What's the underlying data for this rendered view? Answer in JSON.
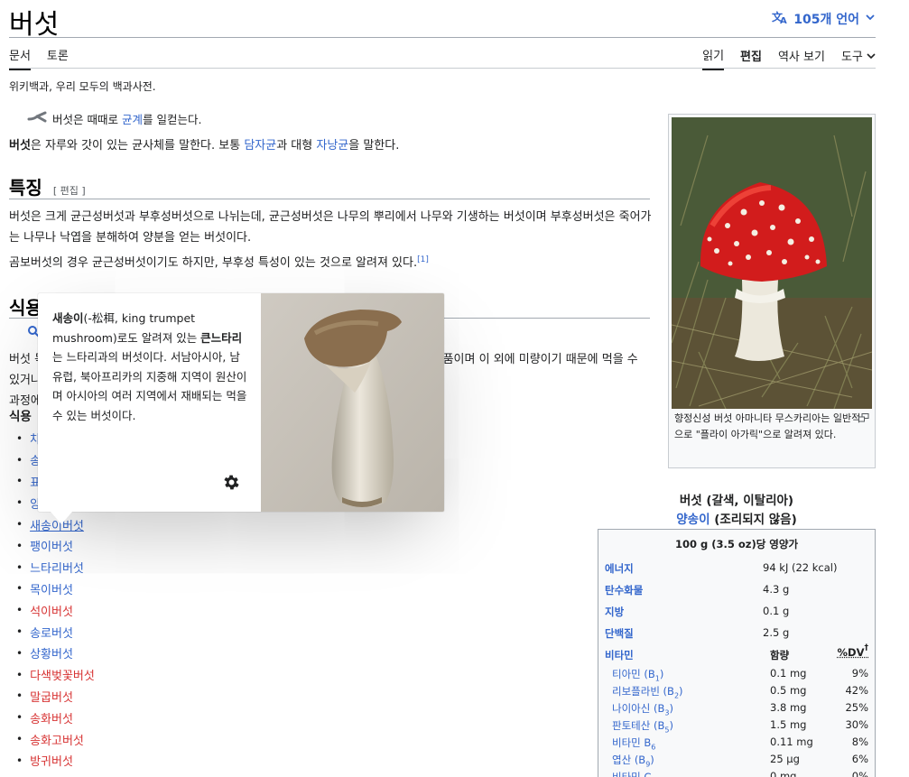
{
  "header": {
    "title": "버섯",
    "languages_label": "105개 언어"
  },
  "tabs_left": [
    "문서",
    "토론"
  ],
  "tabs_right": {
    "read": "읽기",
    "edit": "편집",
    "history": "역사 보기",
    "tools": "도구"
  },
  "tagline": "위키백과, 우리 모두의 백과사전.",
  "hatnote": {
    "before": "버섯은 때때로 ",
    "link": "균계",
    "after": "를 일컫는다."
  },
  "intro": {
    "bold": "버섯",
    "t1": "은 자루와 갓이 있는 균사체를 말한다. 보통 ",
    "link1": "담자균",
    "t2": "과 대형 ",
    "link2": "자낭균",
    "t3": "을 말한다."
  },
  "section1": {
    "heading": "특징",
    "edit_label": "[ 편집 ]",
    "para1": "버섯은 크게 균근성버섯과 부후성버섯으로 나뉘는데, 균근성버섯은 나무의 뿌리에서 나무와 기생하는 버섯이며 부후성버섯은 죽어가는 나무나 낙엽을 분해하여 양분을 얻는 버섯이다.",
    "para2": "곰보버섯의 경우 균근성버섯이기도 하지만, 부후성 특성이 있는 것으로 알려져 있다.",
    "ref": "[1]"
  },
  "section2": {
    "heading": "식용",
    "para_part1": "버섯",
    "para_part2": "독이 있는 것도 있다. 하지만 대부분 저칼로리, 저지방, 고섬유질 식품이어서 건강 식품이며 이 외에 미량이기 때문에 먹을 수 있거나 조리",
    "para_part3": "과정에",
    "para_end": "흔히",
    "subhead": "식용"
  },
  "food_list": [
    {
      "label": "차",
      "red": false
    },
    {
      "label": "송",
      "red": false
    },
    {
      "label": "표",
      "red": false
    },
    {
      "label": "양",
      "red": false
    },
    {
      "label": "새송이버섯",
      "red": false
    },
    {
      "label": "팽이버섯",
      "red": false
    },
    {
      "label": "느타리버섯",
      "red": false
    },
    {
      "label": "목이버섯",
      "red": false
    },
    {
      "label": "석이버섯",
      "red": true
    },
    {
      "label": "송로버섯",
      "red": false
    },
    {
      "label": "상황버섯",
      "red": false
    },
    {
      "label": "다색벚꽃버섯",
      "red": true
    },
    {
      "label": "말굽버섯",
      "red": true
    },
    {
      "label": "송화버섯",
      "red": true
    },
    {
      "label": "송화고버섯",
      "red": true
    },
    {
      "label": "방귀버섯",
      "red": true
    }
  ],
  "thumb": {
    "caption": "향정신성 버섯 아마니타 무스카리아는 일반적으로 \"플라이 아가릭\"으로 알려져 있다."
  },
  "infobox": {
    "title_line1": "버섯 (갈색, 이탈리아)",
    "title_link": "양송이",
    "title_rest": " (조리되지 않음)",
    "per": "100 g (3.5 oz)당 영양가",
    "rows": [
      {
        "k": "에너지",
        "v": "94 kJ (22 kcal)"
      },
      {
        "k": "탄수화물",
        "v": "4.3 g"
      },
      {
        "k": "지방",
        "v": "0.1 g"
      },
      {
        "k": "단백질",
        "v": "2.5 g"
      }
    ],
    "vitamin_label": "비타민",
    "amount_label": "함량",
    "dv_label": "%DV",
    "dv_sup": "†",
    "vitamins": [
      {
        "k": "티아민 (B",
        "sub": "1",
        "end": ")",
        "v": "0.1 mg",
        "p": "9%"
      },
      {
        "k": "리보플라빈 (B",
        "sub": "2",
        "end": ")",
        "v": "0.5 mg",
        "p": "42%"
      },
      {
        "k": "나이아신 (B",
        "sub": "3",
        "end": ")",
        "v": "3.8 mg",
        "p": "25%"
      },
      {
        "k": "판토테산 (B",
        "sub": "5",
        "end": ")",
        "v": "1.5 mg",
        "p": "30%"
      },
      {
        "k": "비타민 B",
        "sub": "6",
        "end": "",
        "v": "0.11 mg",
        "p": "8%"
      },
      {
        "k": "엽산 (B",
        "sub": "9",
        "end": ")",
        "v": "25 μg",
        "p": "6%"
      },
      {
        "k": "비타민 C",
        "sub": "",
        "end": "",
        "v": "0 mg",
        "p": "0%"
      }
    ]
  },
  "popup": {
    "bold1": "새송이",
    "t1": "(-松栮, king trumpet mushroom)로도 알려져 있는 ",
    "bold2": "큰느타리",
    "t2": "는 느타리과의 버섯이다. 서남아시아, 남유럽, 북아프리카의 지중해 지역이 원산이며 아시아의 여러 지역에서 재배되는 먹을 수 있는 버섯이다."
  }
}
